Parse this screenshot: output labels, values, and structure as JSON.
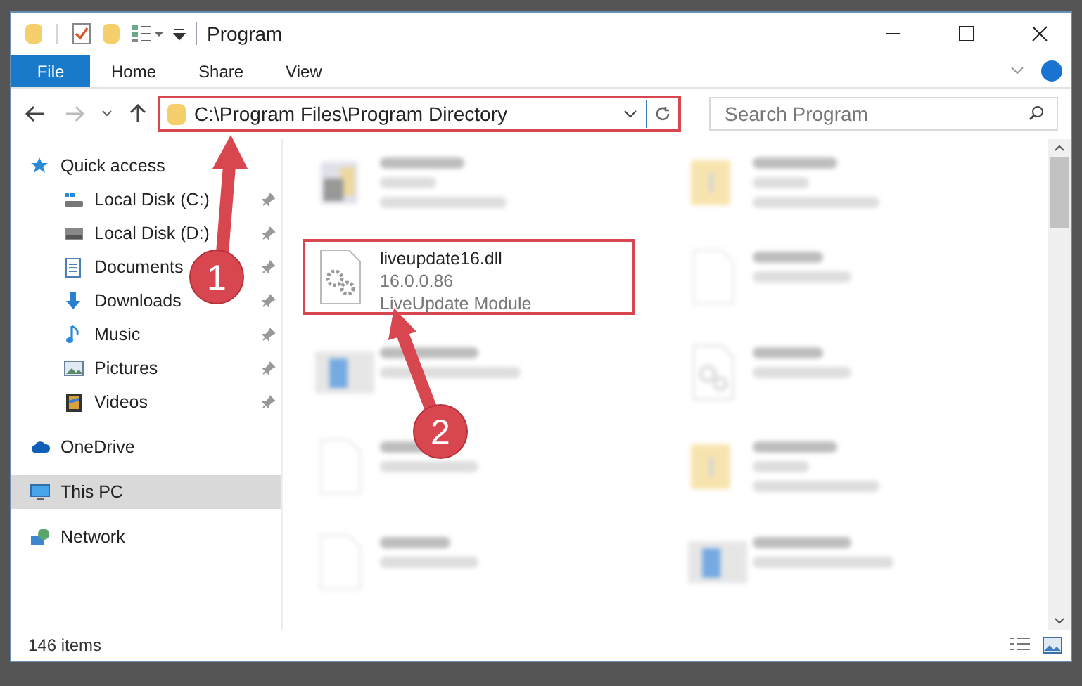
{
  "window": {
    "title": "Program"
  },
  "ribbon": {
    "tabs": [
      {
        "label": "File",
        "kind": "file",
        "selected": false
      },
      {
        "label": "Home",
        "kind": "tab",
        "selected": false
      },
      {
        "label": "Share",
        "kind": "tab",
        "selected": false
      },
      {
        "label": "View",
        "kind": "tab",
        "selected": false
      }
    ]
  },
  "address": {
    "path": "C:\\Program Files\\Program Directory",
    "highlighted": true
  },
  "search": {
    "placeholder": "Search Program"
  },
  "sidebar": {
    "items": [
      {
        "label": "Quick access",
        "kind": "star",
        "selected": false,
        "children": [
          {
            "label": "Local Disk (C:)",
            "kind": "disk-c",
            "pinned": true,
            "selected": false
          },
          {
            "label": "Local Disk (D:)",
            "kind": "disk",
            "pinned": true,
            "selected": false
          },
          {
            "label": "Documents",
            "kind": "document",
            "pinned": true,
            "selected": false
          },
          {
            "label": "Downloads",
            "kind": "download",
            "pinned": true,
            "selected": false
          },
          {
            "label": "Music",
            "kind": "music",
            "pinned": true,
            "selected": false
          },
          {
            "label": "Pictures",
            "kind": "pictures",
            "pinned": true,
            "selected": false
          },
          {
            "label": "Videos",
            "kind": "videos",
            "pinned": true,
            "selected": false
          }
        ]
      },
      {
        "label": "OneDrive",
        "kind": "cloud",
        "selected": false
      },
      {
        "label": "This PC",
        "kind": "pc",
        "selected": true
      },
      {
        "label": "Network",
        "kind": "network",
        "selected": false
      }
    ]
  },
  "files": [
    {
      "kind": "exe",
      "highlighted": false
    },
    {
      "kind": "folder",
      "highlighted": false
    },
    {
      "kind": "dll",
      "name": "liveupdate16.dll",
      "lines": [
        "16.0.0.86",
        "LiveUpdate Module"
      ],
      "highlighted": true
    },
    {
      "kind": "file",
      "highlighted": false
    },
    {
      "kind": "app",
      "highlighted": false
    },
    {
      "kind": "dll",
      "highlighted": false
    },
    {
      "kind": "file",
      "highlighted": false
    },
    {
      "kind": "folder",
      "highlighted": false
    },
    {
      "kind": "file",
      "highlighted": false
    },
    {
      "kind": "app",
      "highlighted": false
    }
  ],
  "status_bar": {
    "count": "146 items"
  },
  "annotations": [
    {
      "label": "1",
      "kind": "arrow-up"
    },
    {
      "label": "2",
      "kind": "arrow-diag"
    }
  ]
}
